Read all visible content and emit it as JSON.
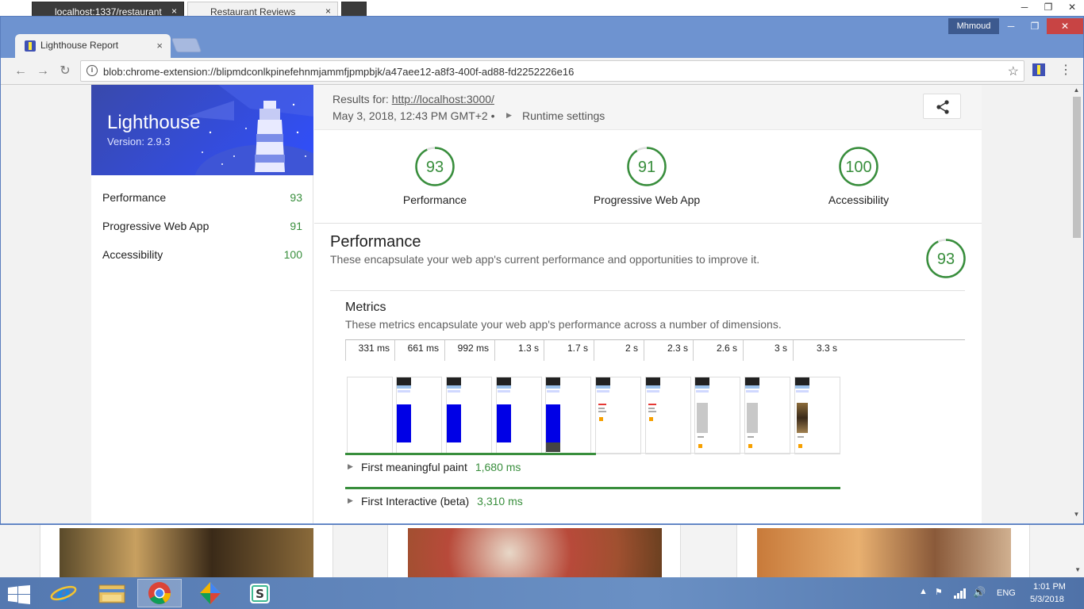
{
  "back_window": {
    "tabs": [
      {
        "label": "localhost:1337/restaurant",
        "close": "×"
      },
      {
        "label": "Restaurant Reviews",
        "close": "×"
      }
    ],
    "controls": [
      "─",
      "❐",
      "✕"
    ]
  },
  "window": {
    "user": "Mhmoud",
    "controls": {
      "minimize": "─",
      "restore": "❐",
      "close": "✕"
    },
    "tab": {
      "title": "Lighthouse Report",
      "close": "×"
    },
    "toolbar": {
      "back": "←",
      "forward": "→",
      "reload": "↻",
      "url": "blob:chrome-extension://blipmdconlkpinefehnmjammfjpmpbjk/a47aee12-a8f3-400f-ad88-fd2252226e16",
      "info": "i",
      "star": "☆",
      "menu": "⋮"
    }
  },
  "report": {
    "header": {
      "title": "Lighthouse",
      "version": "Version: 2.9.3"
    },
    "nav": [
      {
        "label": "Performance",
        "score": "93"
      },
      {
        "label": "Progressive Web App",
        "score": "91"
      },
      {
        "label": "Accessibility",
        "score": "100"
      }
    ],
    "topbar": {
      "results_for_label": "Results for:",
      "url": "http://localhost:3000/",
      "date": "May 3, 2018, 12:43 PM GMT+2 •",
      "runtime": "Runtime settings"
    },
    "gauges": [
      {
        "score": "93",
        "value": 0.93,
        "label": "Performance"
      },
      {
        "score": "91",
        "value": 0.91,
        "label": "Progressive Web App"
      },
      {
        "score": "100",
        "value": 1.0,
        "label": "Accessibility"
      }
    ],
    "performance": {
      "title": "Performance",
      "description": "These encapsulate your web app's current performance and opportunities to improve it.",
      "score": "93",
      "value": 0.93
    },
    "metrics": {
      "title": "Metrics",
      "description": "These metrics encapsulate your web app's performance across a number of dimensions.",
      "filmstrip_times": [
        "331 ms",
        "661 ms",
        "992 ms",
        "1.3 s",
        "1.7 s",
        "2 s",
        "2.3 s",
        "2.6 s",
        "3 s",
        "3.3 s"
      ],
      "items": [
        {
          "label": "First meaningful paint",
          "value": "1,680 ms",
          "fraction": 0.507
        },
        {
          "label": "First Interactive (beta)",
          "value": "3,310 ms",
          "fraction": 1.0
        }
      ]
    }
  },
  "taskbar": {
    "language": "ENG",
    "time": "1:01 PM",
    "date": "5/3/2018"
  },
  "colors": {
    "accent_green": "#388e3c",
    "lighthouse_blue": "#304ffe",
    "window_frame": "#6e93d0",
    "taskbar": "#5a82b8"
  }
}
